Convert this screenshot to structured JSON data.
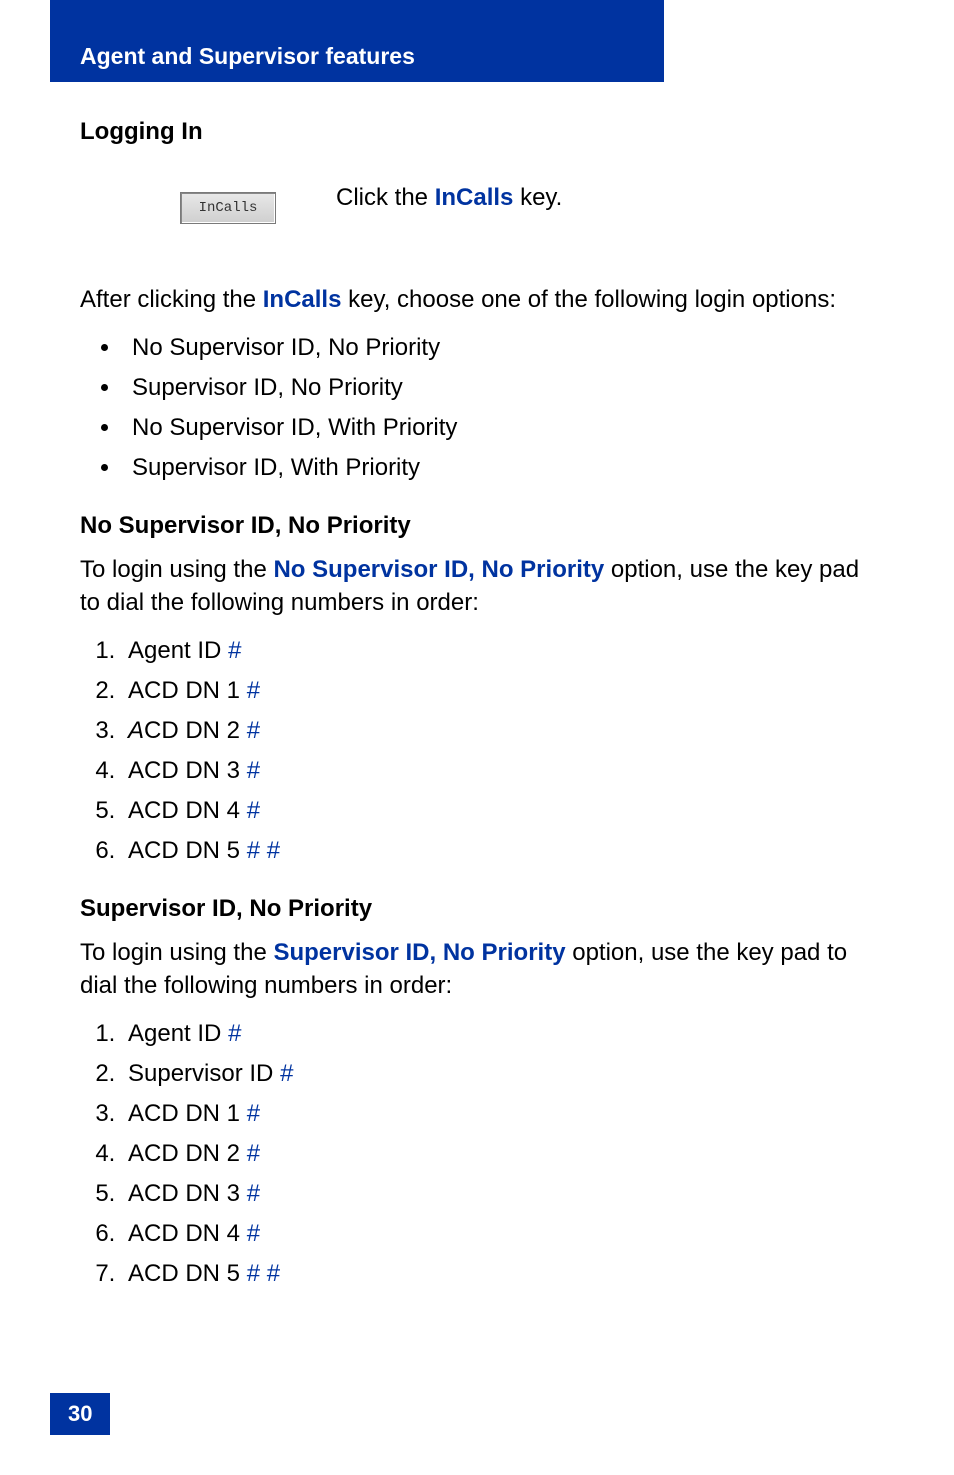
{
  "header": {
    "title": "Agent and Supervisor features"
  },
  "section": {
    "title": "Logging In",
    "button": {
      "label": "InCalls"
    },
    "click_line": {
      "pre": "Click the ",
      "link": "InCalls",
      "post": " key."
    },
    "intro": {
      "pre": "After clicking the ",
      "link": "InCalls",
      "post": " key, choose one of the following login options:"
    },
    "options": [
      "No Supervisor ID, No Priority",
      "Supervisor ID, No Priority",
      "No Supervisor ID, With Priority",
      "Supervisor ID, With Priority"
    ],
    "sec1": {
      "title": "No Supervisor ID, No Priority",
      "intro_pre": "To login using the ",
      "intro_link": "No Supervisor ID, No Priority",
      "intro_post": " option, use the key pad to dial the following numbers in order:",
      "items": [
        {
          "text": "Agent ID ",
          "hash": "#",
          "prefixItalicA": false
        },
        {
          "text": "ACD DN 1 ",
          "hash": "#",
          "prefixItalicA": false
        },
        {
          "text": "CD DN 2 ",
          "hash": "#",
          "prefixItalicA": true
        },
        {
          "text": "ACD DN 3 ",
          "hash": "#",
          "prefixItalicA": false
        },
        {
          "text": "ACD DN 4 ",
          "hash": "#",
          "prefixItalicA": false
        },
        {
          "text": "ACD DN 5 ",
          "hash": "# #",
          "prefixItalicA": false
        }
      ]
    },
    "sec2": {
      "title": "Supervisor ID, No Priority",
      "intro_pre": "To login using the ",
      "intro_link": "Supervisor ID, No Priority",
      "intro_post": " option, use the key pad to dial the following numbers in order:",
      "items": [
        {
          "text": "Agent ID ",
          "hash": "#"
        },
        {
          "text": "Supervisor ID ",
          "hash": "#"
        },
        {
          "text": "ACD DN 1 ",
          "hash": "#"
        },
        {
          "text": "ACD DN 2 ",
          "hash": "#"
        },
        {
          "text": "ACD DN 3 ",
          "hash": "#"
        },
        {
          "text": "ACD DN 4 ",
          "hash": "#"
        },
        {
          "text": "ACD DN 5 ",
          "hash": "# #"
        }
      ]
    }
  },
  "footer": {
    "page": "30"
  }
}
